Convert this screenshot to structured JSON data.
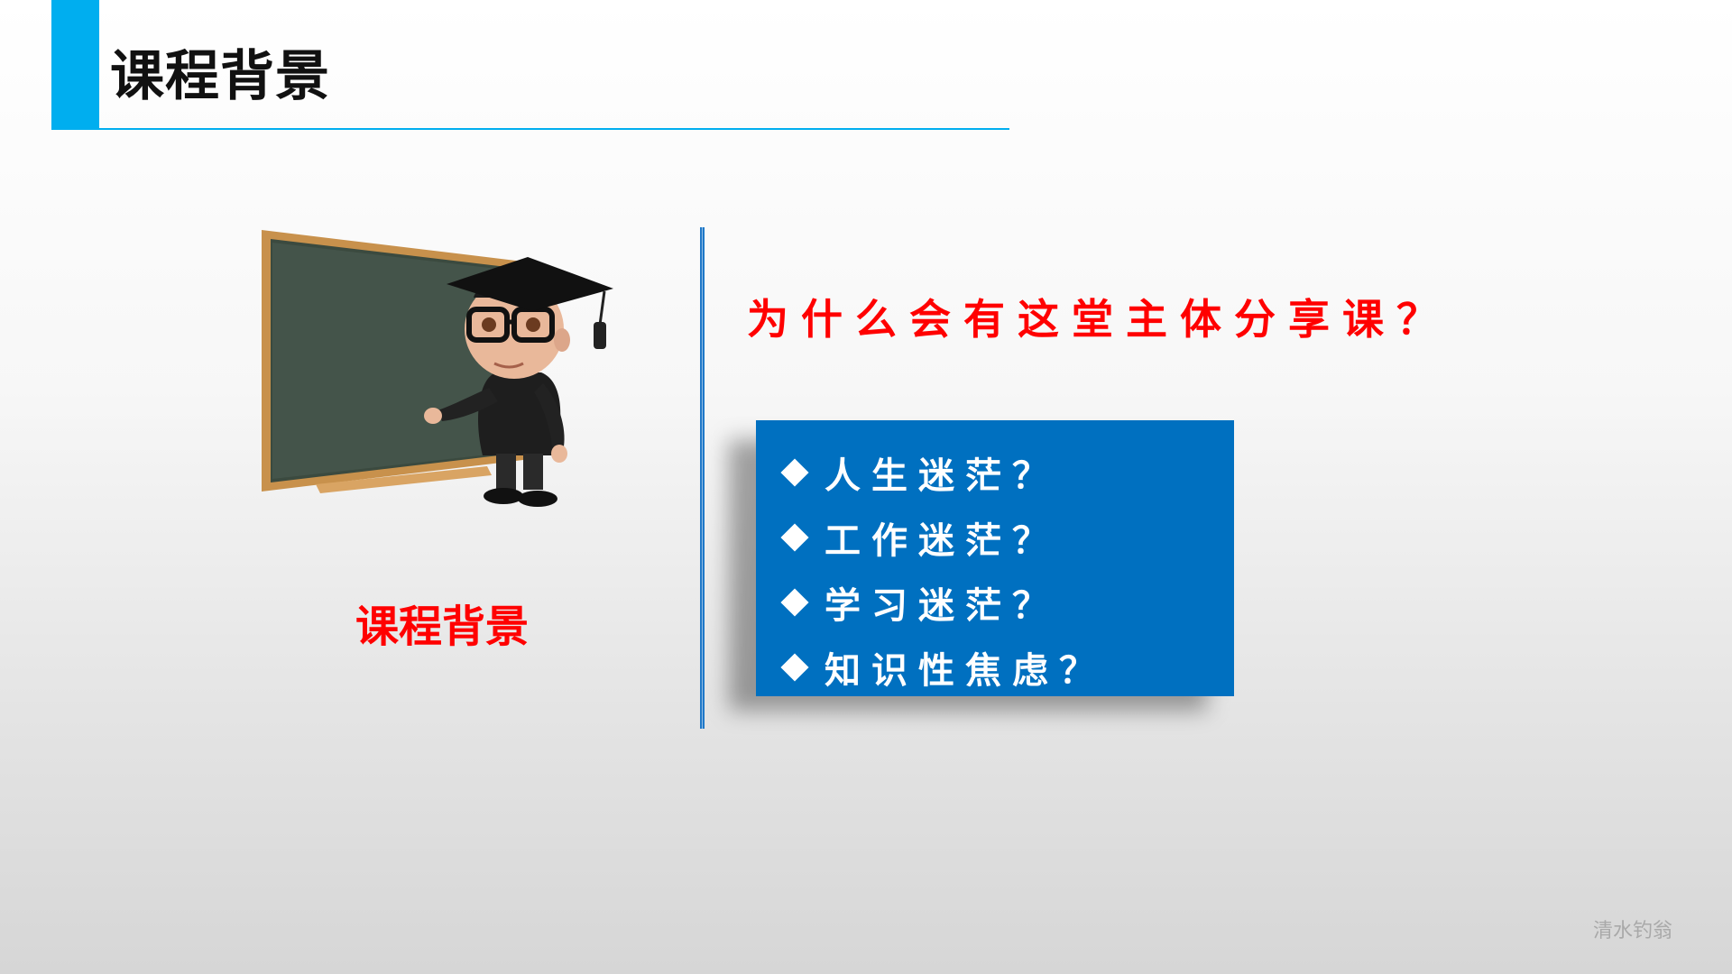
{
  "header": {
    "title": "课程背景"
  },
  "left": {
    "caption": "课程背景"
  },
  "right": {
    "question": "为什么会有这堂主体分享课？",
    "items": [
      {
        "label": "人生迷茫？"
      },
      {
        "label": "工作迷茫？"
      },
      {
        "label": "学习迷茫？"
      },
      {
        "label": "知识性焦虑？"
      }
    ]
  },
  "footer": {
    "watermark": "清水钓翁"
  },
  "colors": {
    "accent": "#00aeef",
    "highlight_red": "#ff0000",
    "box_blue": "#0070c0"
  },
  "icons": [
    "diamond-bullet-icon",
    "graduate-teacher-illustration"
  ]
}
